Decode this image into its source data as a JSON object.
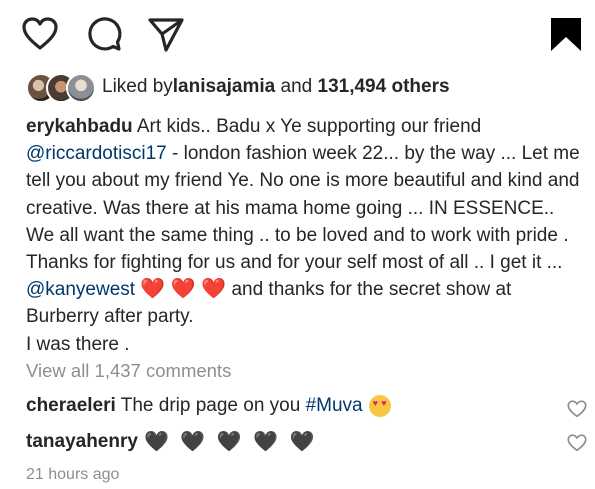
{
  "post": {
    "likes": {
      "prefix": "Liked by ",
      "user": "lanisajamia",
      "middle": " and ",
      "count": "131,494 others"
    },
    "caption": {
      "username": "erykahbadu",
      "text1": " Art kids.. Badu x Ye supporting our friend ",
      "mention1": "@riccardotisci17",
      "text2": " - london fashion week 22... by the way ... Let me tell you about my friend Ye. No one is more beautiful and kind and creative. Was there at his mama home going ... IN ESSENCE.. We all want the same thing .. to be loved and to work with pride . Thanks for fighting for us and for your self most of all .. I get it ... ",
      "mention2": "@kanyewest",
      "hearts": "❤️ ❤️ ❤️",
      "text3": " and thanks for the secret show at Burberry after party.",
      "line2": "I was there ."
    },
    "view_all": "View all 1,437 comments",
    "comments": [
      {
        "username": "cheraeleri",
        "text": " The drip page on you ",
        "hashtag": "#Muva"
      },
      {
        "username": "tanayahenry",
        "text": "🖤 🖤 🖤 🖤 🖤"
      }
    ],
    "timestamp": "21 hours ago"
  },
  "icons": {
    "like": "heart-outline-icon",
    "comment": "comment-bubble-icon",
    "share": "paper-plane-icon",
    "save": "bookmark-filled-icon"
  },
  "colors": {
    "text": "#262626",
    "mention": "#00376b",
    "muted": "#8e8e8e",
    "heart_red": "#ed4956"
  }
}
